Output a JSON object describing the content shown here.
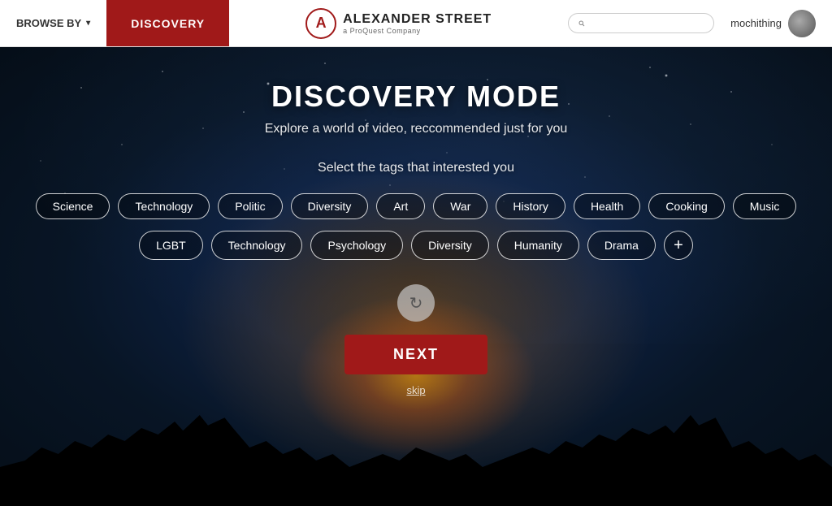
{
  "header": {
    "browse_label": "BROWSE BY",
    "discovery_label": "DISCOVERY",
    "logo_letter": "A",
    "logo_main": "ALEXANDER STREET",
    "logo_sub": "a ProQuest Company",
    "search_placeholder": "",
    "username": "mochithing"
  },
  "main": {
    "title": "DISCOVERY MODE",
    "subtitle": "Explore a world of video, reccommended just for you",
    "tags_prompt": "Select the tags that interested you",
    "row1_tags": [
      "Science",
      "Technology",
      "Politic",
      "Diversity",
      "Art",
      "War",
      "History",
      "Health",
      "Cooking",
      "Music"
    ],
    "row2_tags": [
      "LGBT",
      "Technology",
      "Psychology",
      "Diversity",
      "Humanity",
      "Drama"
    ],
    "next_label": "NEXT",
    "skip_label": "skip"
  }
}
